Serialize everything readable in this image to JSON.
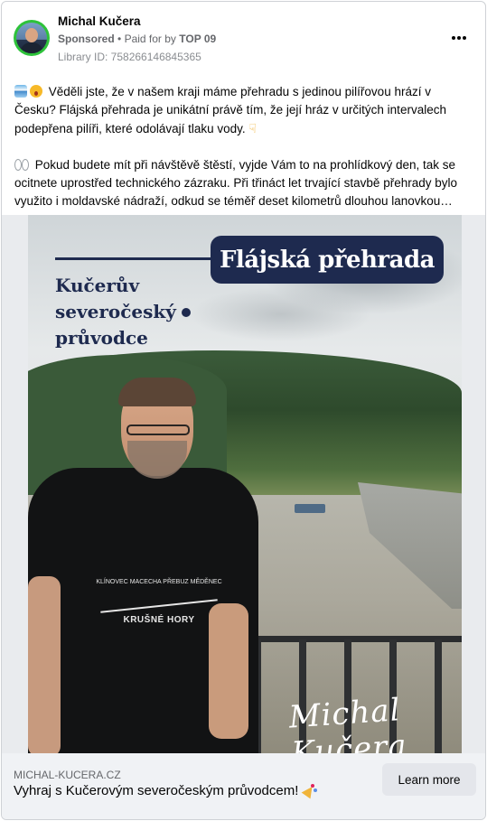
{
  "post": {
    "author": "Michal Kučera",
    "sponsored_label": "Sponsored",
    "separator": "•",
    "paid_for_prefix": "Paid for by",
    "paid_for_by": "TOP 09",
    "library_id": "Library ID: 758266146845365",
    "more_icon": "more-horizontal-icon"
  },
  "text": {
    "paragraph1": "Věděli jste, že v našem kraji máme přehradu s jedinou pilířovou hrází v Česku? Flájská přehrada je unikátní právě tím, že její hráz v určitých intervalech podepřena pilíři, které odolávají tlaku vody.",
    "paragraph2": "Pokud budete mít při návštěvě štěstí, vyjde Vám to na prohlídkový den, tak se ocitnete uprostřed technického zázraku. Při třináct let trvající stavbě přehrady bylo využito i moldavské nádraží, odkud se téměř deset kilometrů dlouhou lanovkou…"
  },
  "image": {
    "headline": "Flájská přehrada",
    "guide_title_line1": "Kučerův",
    "guide_title_line2": "severočeský",
    "guide_title_line3": "průvodce",
    "shirt_text_top": "KLÍNOVEC  MACECHA  PŘEBUZ  MĚDĚNEC",
    "shirt_brand": "KRUŠNÉ HORY",
    "signature": "Michal Kučera"
  },
  "footer": {
    "domain": "MICHAL-KUCERA.CZ",
    "headline": "Vyhraj s Kučerovým severočeským průvodcem!",
    "button": "Learn more"
  },
  "colors": {
    "navy": "#1e2a4f",
    "avatar_ring": "#2dc23a",
    "footer_bg": "#f0f2f5",
    "button_bg": "#e4e6eb"
  }
}
